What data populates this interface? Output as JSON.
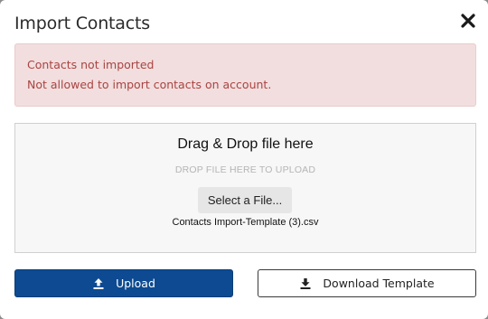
{
  "modal": {
    "title": "Import Contacts",
    "close_icon": "close-icon"
  },
  "alert": {
    "line1": "Contacts not imported",
    "line2": "Not allowed to import contacts on account."
  },
  "dropzone": {
    "title": "Drag & Drop file here",
    "subtitle": "DROP FILE HERE TO UPLOAD",
    "select_label": "Select a File...",
    "file_name": "Contacts Import-Template (3).csv"
  },
  "actions": {
    "upload_label": "Upload",
    "upload_icon": "upload-icon",
    "download_label": "Download Template",
    "download_icon": "download-icon"
  },
  "colors": {
    "primary": "#0d4a91",
    "alert_bg": "#f2dede",
    "alert_text": "#a94442"
  }
}
